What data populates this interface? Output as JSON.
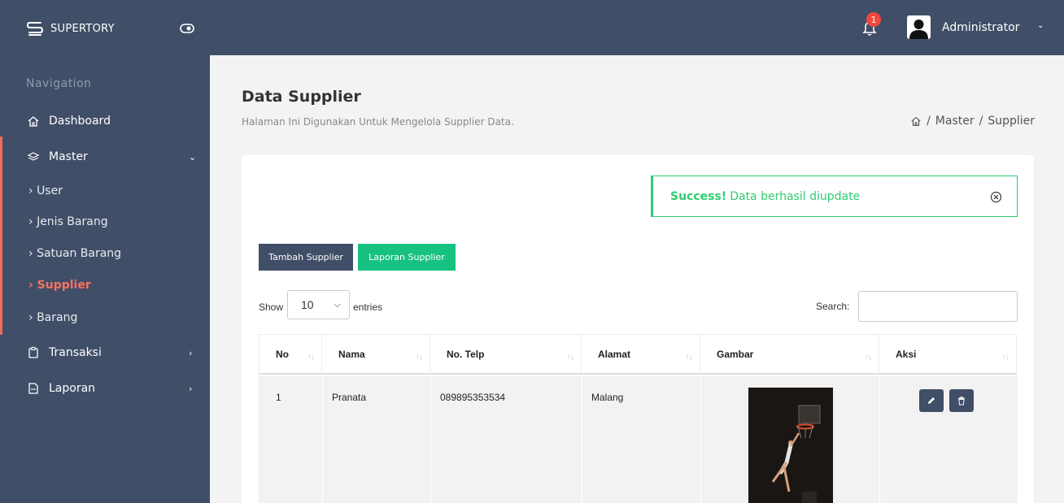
{
  "brand": {
    "name": "SUPERTORY"
  },
  "topbar": {
    "notification_count": "1",
    "user_name": "Administrator"
  },
  "sidebar": {
    "title": "Navigation",
    "items": [
      {
        "label": "Dashboard"
      },
      {
        "label": "Master",
        "expanded": true,
        "children": [
          {
            "label": "User"
          },
          {
            "label": "Jenis Barang"
          },
          {
            "label": "Satuan Barang"
          },
          {
            "label": "Supplier",
            "active": true
          },
          {
            "label": "Barang"
          }
        ]
      },
      {
        "label": "Transaksi"
      },
      {
        "label": "Laporan"
      }
    ]
  },
  "page": {
    "title": "Data Supplier",
    "subtitle": "Halaman Ini Digunakan Untuk Mengelola Supplier Data.",
    "breadcrumb": [
      "Master",
      "Supplier"
    ]
  },
  "alert": {
    "strong": "Success!",
    "message": "Data berhasil diupdate"
  },
  "buttons": {
    "add": "Tambah Supplier",
    "report": "Laporan Supplier"
  },
  "table_controls": {
    "show_label": "Show",
    "entries_value": "10",
    "entries_label": "entries",
    "search_label": "Search:"
  },
  "table": {
    "headers": [
      "No",
      "Nama",
      "No. Telp",
      "Alamat",
      "Gambar",
      "Aksi"
    ],
    "rows": [
      {
        "no": "1",
        "nama": "Pranata",
        "telp": "089895353534",
        "alamat": "Malang"
      }
    ]
  },
  "colors": {
    "nav_bg": "#404e67",
    "accent_red": "#f06d5b",
    "success_green": "#2ecc71",
    "button_green": "#17c281"
  }
}
